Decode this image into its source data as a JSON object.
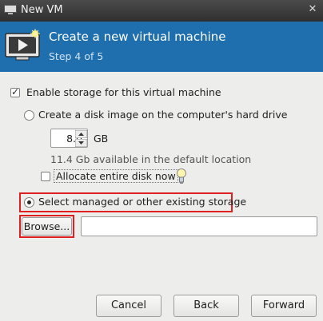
{
  "window": {
    "title": "New VM"
  },
  "header": {
    "title": "Create a new virtual machine",
    "step": "Step 4 of 5"
  },
  "storage": {
    "enable_label": "Enable storage for this virtual machine",
    "enable_checked": true,
    "create_disk_label": "Create a disk image on the computer's hard drive",
    "size_value": "8.0",
    "size_unit": "GB",
    "available_text": "11.4 Gb available in the default location",
    "allocate_label": "Allocate entire disk now",
    "allocate_checked": false,
    "managed_label": "Select managed or other existing storage",
    "managed_selected": true,
    "browse_label": "Browse...",
    "path_value": ""
  },
  "footer": {
    "cancel": "Cancel",
    "back": "Back",
    "forward": "Forward"
  },
  "colors": {
    "header_bg": "#1f6fae",
    "highlight": "#e02020"
  }
}
